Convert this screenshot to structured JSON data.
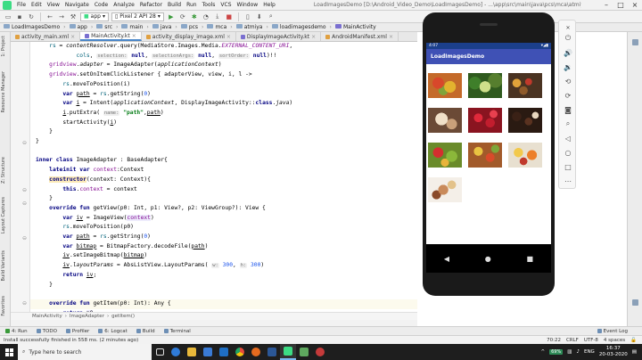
{
  "menubar": {
    "items": [
      "File",
      "Edit",
      "View",
      "Navigate",
      "Code",
      "Analyze",
      "Refactor",
      "Build",
      "Run",
      "Tools",
      "VCS",
      "Window",
      "Help"
    ],
    "title": "LoadImagesDemo [D:\\Android_Video_Demo\\LoadImagesDemo] - ...\\app\\src\\main\\java\\pcs\\mca\\atmiya\\loadimagesdemo\\MainActivity.kt [app]"
  },
  "toolbar": {
    "module": "app",
    "device": "Pixel 2 API 28"
  },
  "breadcrumb": [
    "LoadImagesDemo",
    "app",
    "src",
    "main",
    "java",
    "pcs",
    "mca",
    "atmiya",
    "loadimagesdemo",
    "MainActivity"
  ],
  "tabs": [
    {
      "label": "activity_main.xml",
      "color": "#e0a040",
      "active": false
    },
    {
      "label": "MainActivity.kt",
      "color": "#7a6fd0",
      "active": true
    },
    {
      "label": "activity_display_image.xml",
      "color": "#e0a040",
      "active": false
    },
    {
      "label": "DisplayImageActivity.kt",
      "color": "#7a6fd0",
      "active": false
    },
    {
      "label": "AndroidManifest.xml",
      "color": "#e0a040",
      "active": false
    }
  ],
  "left_strip": [
    "1: Project",
    "Resource Manager",
    "Z: Structure",
    "Layout Captures",
    "Build Variants",
    "Favorites"
  ],
  "code_breadcrumb": [
    "MainActivity",
    "ImageAdapter",
    "getItem()"
  ],
  "emulator": {
    "status_time": "4:07",
    "app_title": "LoadImagesDemo"
  },
  "bottom_tools": [
    "4: Run",
    "TODO",
    "Profiler",
    "6: Logcat",
    "Build",
    "Terminal"
  ],
  "event_log": "Event Log",
  "status": {
    "message": "Install successfully finished in 558 ms. (2 minutes ago)",
    "position": "70:22",
    "line_sep": "CRLF",
    "encoding": "UTF-8",
    "indent": "4 spaces"
  },
  "taskbar": {
    "search_placeholder": "Type here to search",
    "battery": "69%",
    "lang": "ENG",
    "time": "16:37",
    "date": "20-03-2020"
  },
  "colors": {
    "accent": "#3f51b5",
    "status_bar": "#1b3f8b"
  }
}
